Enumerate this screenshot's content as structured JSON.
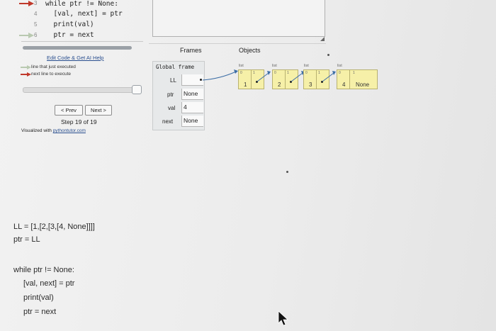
{
  "code": {
    "lines": [
      {
        "num": "3",
        "text": "while ptr != None:"
      },
      {
        "num": "4",
        "text": "  [val, next] = ptr"
      },
      {
        "num": "5",
        "text": "  print(val)"
      },
      {
        "num": "6",
        "text": "  ptr = next"
      }
    ]
  },
  "links": {
    "edit_code": "Edit Code & Get AI Help"
  },
  "legend": {
    "executed": "line that just executed",
    "next": "next line to execute"
  },
  "nav": {
    "prev": "< Prev",
    "next": "Next >",
    "step": "Step 19 of 19",
    "visualized_prefix": "Visualized with ",
    "visualized_link": "pythontutor.com"
  },
  "frames": {
    "heading": "Frames",
    "global": "Global frame",
    "vars": [
      {
        "name": "LL",
        "value": ""
      },
      {
        "name": "ptr",
        "value": "None"
      },
      {
        "name": "val",
        "value": "4"
      },
      {
        "name": "next",
        "value": "None"
      }
    ]
  },
  "objects": {
    "heading": "Objects",
    "lists": [
      {
        "label": "list",
        "items": [
          {
            "idx": "0",
            "val": "1"
          },
          {
            "idx": "1",
            "val": ""
          }
        ]
      },
      {
        "label": "list",
        "items": [
          {
            "idx": "0",
            "val": "2"
          },
          {
            "idx": "1",
            "val": ""
          }
        ]
      },
      {
        "label": "list",
        "items": [
          {
            "idx": "0",
            "val": "3"
          },
          {
            "idx": "1",
            "val": ""
          }
        ]
      },
      {
        "label": "list",
        "items": [
          {
            "idx": "0",
            "val": "4"
          },
          {
            "idx": "1",
            "val": "None"
          }
        ]
      }
    ]
  },
  "bottom": {
    "line1": "LL = [1,[2,[3,[4, None]]]]",
    "line2": "ptr = LL",
    "line3": "while ptr != None:",
    "line4": "[val, next] = ptr",
    "line5": "print(val)",
    "line6": "ptr = next"
  },
  "colors": {
    "executed_arrow": "#b9c9b0",
    "next_arrow": "#c0392b",
    "object_fill": "#f6f0a8"
  }
}
